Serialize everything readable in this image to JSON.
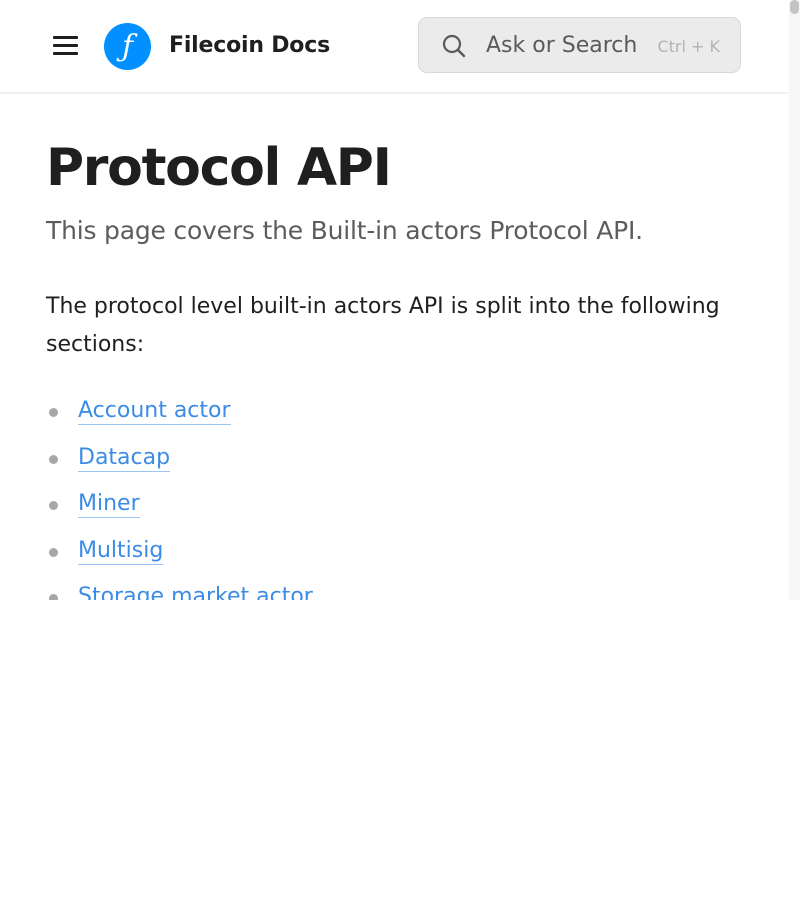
{
  "header": {
    "menu_icon": "hamburger-menu-icon",
    "logo_icon": "filecoin-logo-icon",
    "logo_color": "#0090ff",
    "brand": "Filecoin Docs",
    "search": {
      "icon": "search-icon",
      "placeholder": "Ask or Search",
      "shortcut": "Ctrl + K"
    }
  },
  "page": {
    "title": "Protocol API",
    "subtitle": "This page covers the Built-in actors Protocol API.",
    "intro": "The protocol level built-in actors API is split into the following sections:",
    "sections": [
      "Account actor",
      "Datacap",
      "Miner",
      "Multisig",
      "Storage market actor"
    ]
  },
  "colors": {
    "link": "#3c8ce6",
    "text": "#1f1f1f",
    "muted": "#5c5c5c"
  }
}
